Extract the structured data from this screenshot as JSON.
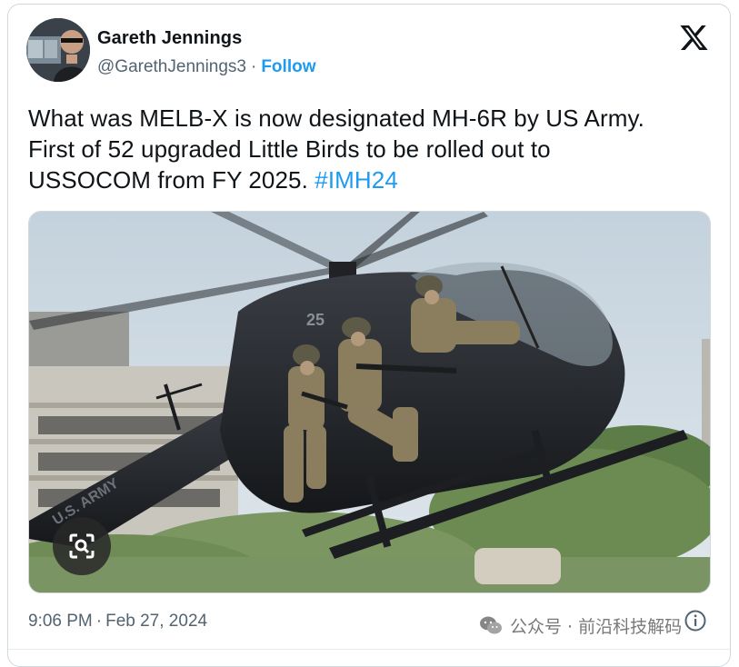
{
  "author": {
    "name": "Gareth Jennings",
    "handle": "@GarethJennings3",
    "separator": "·",
    "follow_label": "Follow"
  },
  "tweet": {
    "text_line1": "What was MELB-X is now designated MH-6R by US Army.",
    "text_line2": "First of 52 upgraded Little Birds to be rolled out to",
    "text_line3": "USSOCOM from FY 2025.",
    "hashtag": "#IMH24"
  },
  "media": {
    "helicopter_tail_text": "U.S. ARMY",
    "helicopter_number": "25",
    "lens_icon": "visual-search-icon"
  },
  "footer": {
    "time": "9:06 PM",
    "separator": "·",
    "date": "Feb 27, 2024",
    "info_icon": "info-icon"
  },
  "watermark": {
    "text": "公众号 · 前沿科技解码",
    "icon": "wechat-icon"
  },
  "icons": {
    "logo": "x-logo-icon"
  },
  "colors": {
    "accent": "#1d9bf0",
    "text": "#0f1419",
    "secondary": "#536471",
    "border": "#cfd9de"
  }
}
